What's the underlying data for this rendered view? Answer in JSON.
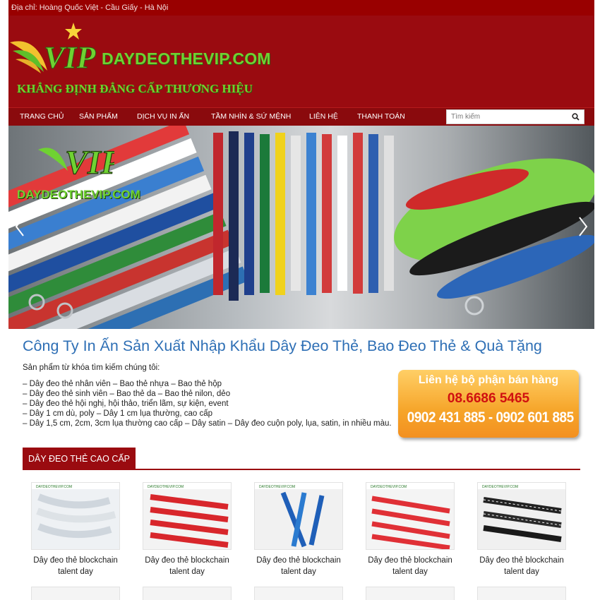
{
  "topbar": {
    "address": "Địa chỉ: Hoàng Quốc Việt - Cầu Giấy - Hà Nội"
  },
  "logo": {
    "site_name": "DAYDEOTHEVIP.COM",
    "slogan": "KHẲNG ĐỊNH ĐẲNG CẤP THƯƠNG HIỆU",
    "mark": "VIP"
  },
  "nav": {
    "items": [
      "TRANG CHỦ",
      "SẢN PHẨM",
      "DỊCH VỤ IN ẤN",
      "TẦM NHÌN & SỨ MỆNH",
      "LIÊN HỆ",
      "THANH TOÁN"
    ],
    "search_placeholder": "Tìm kiếm"
  },
  "banner": {
    "logo_text": "DAYDEOTHEVIP.COM",
    "logo_mark": "VIP"
  },
  "main": {
    "title": "Công Ty In Ấn Sản Xuất Nhập Khẩu Dây Đeo Thẻ, Bao Đeo Thẻ & Quà Tặng",
    "intro": "Sản phẩm từ khóa tìm kiếm chúng tôi:",
    "keywords": [
      "– Dây đeo thẻ nhân viên – Bao thẻ nhựa – Bao thẻ hộp",
      "– Dây đeo thẻ sinh viên – Bao thẻ da – Bao thẻ nilon, dẻo",
      "– Dây đeo thẻ hội nghị, hội thảo, triển lãm, sự kiện, event",
      "– Dây 1 cm dù, poly – Dây 1 cm lụa thường, cao cấp",
      "– Dây 1,5 cm, 2cm, 3cm lụa thường cao cấp – Dây satin – Dây đeo cuộn poly, lụa, satin, in nhiều màu."
    ]
  },
  "contact": {
    "title": "Liên hệ bộ phận bán hàng",
    "phone1": "08.6686 5465",
    "phone2": "0902 431 885 - 0902 601 885"
  },
  "section": {
    "title": "DÂY ĐEO THẺ CAO CẤP"
  },
  "products": [
    {
      "name": "Dây đeo thẻ blockchain talent day"
    },
    {
      "name": "Dây đeo thẻ blockchain talent day"
    },
    {
      "name": "Dây đeo thẻ blockchain talent day"
    },
    {
      "name": "Dây đeo thẻ blockchain talent day"
    },
    {
      "name": "Dây đeo thẻ blockchain talent day"
    }
  ],
  "colors": {
    "brand_red": "#9a0b10",
    "title_blue": "#2e6fb5",
    "logo_green": "#6fd232",
    "contact_orange": "#f6a52a"
  }
}
